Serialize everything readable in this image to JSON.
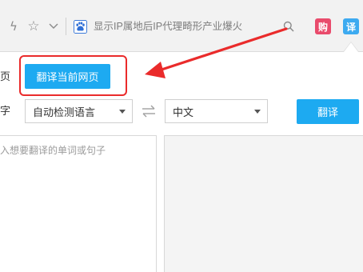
{
  "toolbar": {
    "search_text": "显示IP属地后IP代理畸形产业爆火",
    "shop_icon_text": "购",
    "translate_icon_text": "译",
    "icons": [
      "bolt-icon",
      "star-icon",
      "chevron-down-icon",
      "baidu-paw-icon",
      "search-icon"
    ]
  },
  "translator": {
    "page_label": "页",
    "translate_page_button": "翻译当前网页",
    "text_label": "字",
    "source_language": "自动检测语言",
    "target_language": "中文",
    "translate_button": "翻译",
    "input_placeholder": "入想要翻译的单词或句子"
  },
  "colors": {
    "accent_blue": "#1daaf1",
    "highlight_red": "#ea2b2b",
    "shop_icon_bg": "#e94b6c"
  }
}
